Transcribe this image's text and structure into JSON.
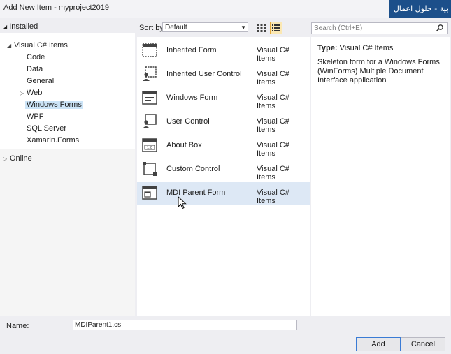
{
  "window": {
    "title": "Add New Item - myproject2019",
    "overlay_text": "بية - حلول اعمال"
  },
  "left_panel": {
    "installed_label": "Installed",
    "tree": [
      {
        "label": "Visual C# Items",
        "expander": "expanded"
      },
      {
        "label": "Code"
      },
      {
        "label": "Data"
      },
      {
        "label": "General"
      },
      {
        "label": "Web",
        "expander": "collapsed"
      },
      {
        "label": "Windows Forms",
        "selected": true
      },
      {
        "label": "WPF"
      },
      {
        "label": "SQL Server"
      },
      {
        "label": "Xamarin.Forms"
      }
    ],
    "online_label": "Online"
  },
  "toolbar": {
    "sort_label": "Sort by:",
    "sort_value": "Default"
  },
  "search": {
    "placeholder": "Search (Ctrl+E)"
  },
  "items": [
    {
      "name": "Inherited Form",
      "type": "Visual C# Items",
      "icon": "inherited-form-icon"
    },
    {
      "name": "Inherited User Control",
      "type": "Visual C# Items",
      "icon": "inherited-user-control-icon"
    },
    {
      "name": "Windows Form",
      "type": "Visual C# Items",
      "icon": "windows-form-icon"
    },
    {
      "name": "User Control",
      "type": "Visual C# Items",
      "icon": "user-control-icon"
    },
    {
      "name": "About Box",
      "type": "Visual C# Items",
      "icon": "about-box-icon"
    },
    {
      "name": "Custom Control",
      "type": "Visual C# Items",
      "icon": "custom-control-icon"
    },
    {
      "name": "MDI Parent Form",
      "type": "Visual C# Items",
      "icon": "mdi-parent-form-icon",
      "selected": true
    }
  ],
  "details": {
    "type_label": "Type:",
    "type_value": "Visual C# Items",
    "description": "Skeleton form for a Windows Forms (WinForms) Multiple Document Interface application"
  },
  "footer": {
    "name_label": "Name:",
    "name_value": "MDIParent1.cs",
    "add_label": "Add",
    "cancel_label": "Cancel"
  },
  "colors": {
    "selection": "#cce4f7",
    "item_selected": "#dde8f5",
    "overlay_bg": "#1c4f8a"
  }
}
